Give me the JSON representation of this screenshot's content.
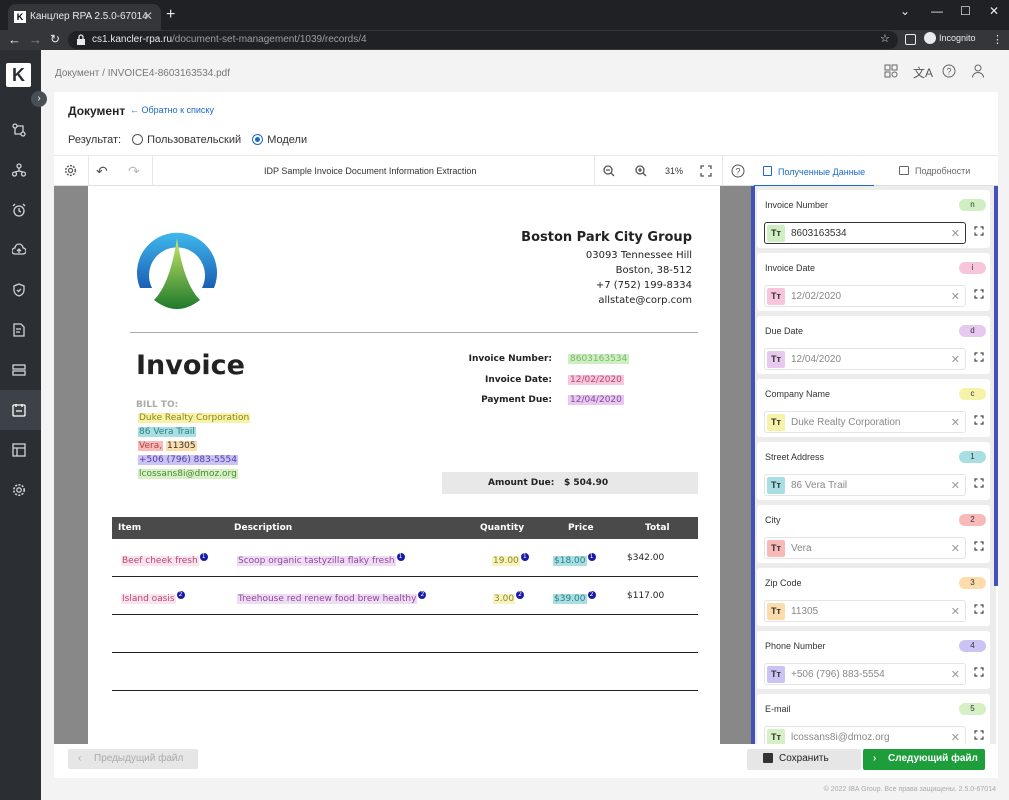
{
  "browser": {
    "tab_title": "Канцлер RPA 2.5.0-67014",
    "url_domain": "cs1.kancler-rpa.ru",
    "url_path": "/document-set-management/1039/records/4",
    "profile": "Incognito"
  },
  "breadcrumb": {
    "root": "Документ",
    "sep": "/",
    "file": "INVOICE4-8603163534.pdf"
  },
  "header": {
    "title": "Документ",
    "back": "Обратно к списку"
  },
  "result": {
    "label": "Результат:",
    "options": [
      "Пользовательский",
      "Модели"
    ],
    "selected": "Модели"
  },
  "toolbar": {
    "doc_label": "IDP Sample Invoice Document Information Extraction",
    "zoom": "31%"
  },
  "invoice": {
    "company": "Boston Park City Group",
    "address": [
      "03093 Tennessee Hill",
      "Boston,  38-512",
      "+7 (752) 199-8334",
      "allstate@corp.com"
    ],
    "title": "Invoice",
    "fields": [
      {
        "label": "Invoice Number:",
        "value": "8603163534"
      },
      {
        "label": "Invoice Date:",
        "value": "12/02/2020"
      },
      {
        "label": "Payment Due:",
        "value": "12/04/2020"
      }
    ],
    "bill_to_label": "BILL TO:",
    "bill_to": {
      "company": "Duke Realty Corporation",
      "street": "86 Vera Trail",
      "city": "Vera,",
      "zip": "11305",
      "phone": "+506 (796) 883-5554",
      "email": "lcossans8i@dmoz.org"
    },
    "amount_label": "Amount Due:",
    "amount_value": "$ 504.90",
    "columns": [
      "Item",
      "Description",
      "Quantity",
      "Price",
      "Total"
    ],
    "rows": [
      {
        "item": "Beef cheek fresh",
        "desc": "Scoop organic tastyzilla flaky fresh",
        "qty": "19.00",
        "price": "$18.00",
        "total": "$342.00",
        "n": "1"
      },
      {
        "item": "Island oasis",
        "desc": "Treehouse red renew food brew healthy",
        "qty": "3.00",
        "price": "$39.00",
        "total": "$117.00",
        "n": "2"
      }
    ]
  },
  "panel": {
    "tabs": [
      "Полученные Данные",
      "Подробности"
    ],
    "fields": [
      {
        "label": "Invoice Number",
        "badge": "n",
        "value": "8603163534",
        "color": "#cfeec2",
        "selected": true
      },
      {
        "label": "Invoice Date",
        "badge": "i",
        "value": "12/02/2020",
        "color": "#f7c6dc"
      },
      {
        "label": "Due Date",
        "badge": "d",
        "value": "12/04/2020",
        "color": "#e7c8ee"
      },
      {
        "label": "Company Name",
        "badge": "c",
        "value": "Duke Realty Corporation",
        "color": "#f6f3a8"
      },
      {
        "label": "Street Address",
        "badge": "1",
        "value": "86 Vera Trail",
        "color": "#a9dfe3"
      },
      {
        "label": "City",
        "badge": "2",
        "value": "Vera",
        "color": "#f8b9b9"
      },
      {
        "label": "Zip Code",
        "badge": "3",
        "value": "11305",
        "color": "#fbdcaa"
      },
      {
        "label": "Phone Number",
        "badge": "4",
        "value": "+506 (796) 883-5554",
        "color": "#cbc3f4"
      },
      {
        "label": "E-mail",
        "badge": "5",
        "value": "lcossans8i@dmoz.org",
        "color": "#d6efc4"
      }
    ],
    "tt": "Tт"
  },
  "footer": {
    "prev": "Предыдущий файл",
    "save": "Сохранить",
    "next": "Следующий файл",
    "copyright": "© 2022 IBA Group. Все права защищены. 2.5.0-67014"
  },
  "colors": {
    "accent": "#1b6ac9",
    "next_button": "#1e9e3a",
    "scroll": "#4352b9"
  }
}
